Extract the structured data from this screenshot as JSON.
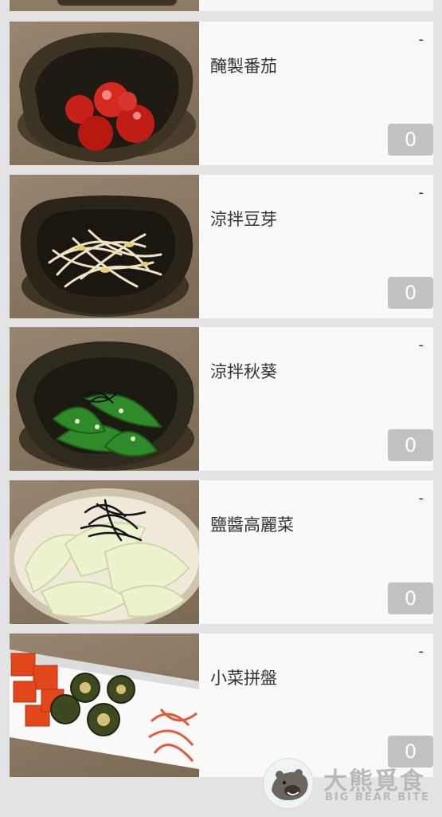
{
  "menu_items": [
    {
      "name": "醃製番茄",
      "price": "-",
      "quantity": "0",
      "image": "pickled-tomato-dish"
    },
    {
      "name": "涼拌豆芽",
      "price": "-",
      "quantity": "0",
      "image": "bean-sprout-dish"
    },
    {
      "name": "涼拌秋葵",
      "price": "-",
      "quantity": "0",
      "image": "okra-dish"
    },
    {
      "name": "鹽醬高麗菜",
      "price": "-",
      "quantity": "0",
      "image": "cabbage-dish"
    },
    {
      "name": "小菜拼盤",
      "price": "-",
      "quantity": "0",
      "image": "side-dish-platter"
    }
  ],
  "watermark": {
    "title": "大熊覓食",
    "subtitle": "BIG BEAR BITE",
    "icon": "bear-logo"
  },
  "colors": {
    "quantity_badge": "#c2c2c2",
    "card_bg": "#f9f9f9",
    "page_bg": "#e3e3e3"
  }
}
